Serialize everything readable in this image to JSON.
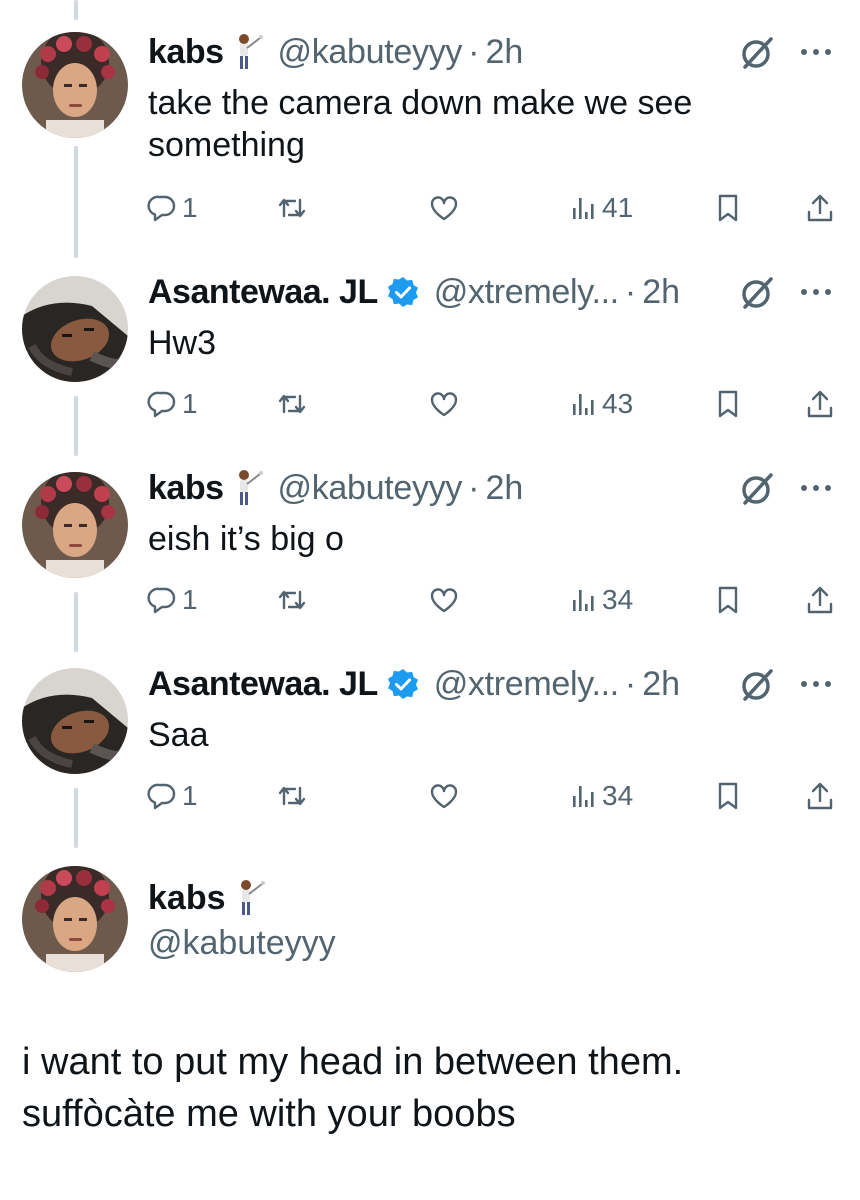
{
  "colors": {
    "text": "#0f1419",
    "secondary": "#536471",
    "thread_line": "#cfd9de",
    "verified": "#1d9bf0"
  },
  "icons": {
    "emoji": "golfer-emoji",
    "verified": "verified-badge-icon",
    "grok": "grok-icon",
    "more": "more-options-icon",
    "reply": "reply-icon",
    "retweet": "retweet-icon",
    "like": "like-icon",
    "views": "views-icon",
    "bookmark": "bookmark-icon",
    "share": "share-icon"
  },
  "thread": [
    {
      "name": "kabs",
      "handle": "@kabuteyyy",
      "separator": "·",
      "time": "2h",
      "verified": false,
      "text": "take the camera down make we see something",
      "replies": "1",
      "views": "41"
    },
    {
      "name": "Asantewaa. JL",
      "handle": "@xtremely...",
      "separator": "·",
      "time": "2h",
      "verified": true,
      "text": "Hw3",
      "replies": "1",
      "views": "43"
    },
    {
      "name": "kabs",
      "handle": "@kabuteyyy",
      "separator": "·",
      "time": "2h",
      "verified": false,
      "text": "eish it’s big o",
      "replies": "1",
      "views": "34"
    },
    {
      "name": "Asantewaa. JL",
      "handle": "@xtremely...",
      "separator": "·",
      "time": "2h",
      "verified": true,
      "text": "Saa",
      "replies": "1",
      "views": "34"
    }
  ],
  "main_tweet": {
    "name": "kabs",
    "handle": "@kabuteyyy",
    "text_line1": "i want to put my head in between them.",
    "text_line2": "suffòcàte me with your boobs"
  }
}
